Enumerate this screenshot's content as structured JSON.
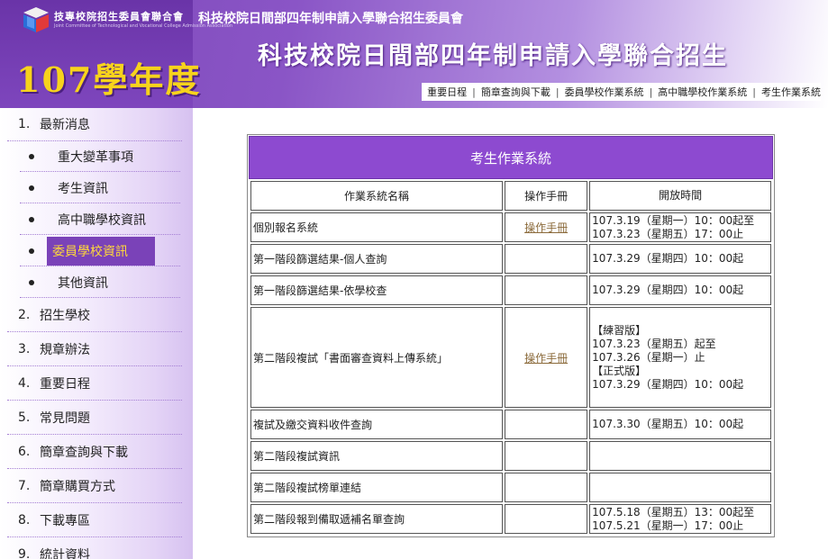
{
  "header": {
    "logo_text": "技專校院招生委員會聯合會",
    "logo_sub": "Joint Committee of Technological and Vocational College Admission Association",
    "year": "107學年度",
    "org_name": "科技校院日間部四年制申請入學聯合招生委員會",
    "title": "科技校院日間部四年制申請入學聯合招生",
    "nav": [
      {
        "label": "重要日程"
      },
      {
        "label": "簡章查詢與下載"
      },
      {
        "label": "委員學校作業系統"
      },
      {
        "label": "高中職學校作業系統"
      },
      {
        "label": "考生作業系統"
      }
    ]
  },
  "sidebar": {
    "items": [
      {
        "num": "1.",
        "label": "最新消息"
      },
      {
        "sub": true,
        "label": "重大變革事項"
      },
      {
        "sub": true,
        "label": "考生資訊"
      },
      {
        "sub": true,
        "label": "高中職學校資訊"
      },
      {
        "sub": true,
        "label": "委員學校資訊",
        "active": true
      },
      {
        "sub": true,
        "label": "其他資訊"
      },
      {
        "num": "2.",
        "label": "招生學校"
      },
      {
        "num": "3.",
        "label": "規章辦法"
      },
      {
        "num": "4.",
        "label": "重要日程"
      },
      {
        "num": "5.",
        "label": "常見問題"
      },
      {
        "num": "6.",
        "label": "簡章查詢與下載"
      },
      {
        "num": "7.",
        "label": "簡章購買方式"
      },
      {
        "num": "8.",
        "label": "下載專區"
      },
      {
        "num": "9.",
        "label": "統計資料"
      }
    ]
  },
  "panel": {
    "title": "考生作業系統",
    "headers": [
      "作業系統名稱",
      "操作手冊",
      "開放時間"
    ],
    "rows": [
      {
        "name": "個別報名系統",
        "manual": "操作手冊",
        "time": [
          "107.3.19（星期一）10：00起至",
          "107.3.23（星期五）17：00止"
        ]
      },
      {
        "name": "第一階段篩選結果-個人查詢",
        "manual": "",
        "time": [
          "107.3.29（星期四）10：00起"
        ]
      },
      {
        "name": "第一階段篩選結果-依學校查",
        "manual": "",
        "time": [
          "107.3.29（星期四）10：00起"
        ]
      },
      {
        "name": "第二階段複試「書面審查資料上傳系統」",
        "manual": "操作手冊",
        "time": [
          "【練習版】",
          "107.3.23（星期五）起至",
          "107.3.26（星期一）止",
          "【正式版】",
          "107.3.29（星期四）10：00起"
        ]
      },
      {
        "name": "複試及繳交資料收件查詢",
        "manual": "",
        "time": [
          "107.3.30（星期五）10：00起"
        ]
      },
      {
        "name": "第二階段複試資訊",
        "manual": "",
        "time": []
      },
      {
        "name": "第二階段複試榜單連結",
        "manual": "",
        "time": []
      },
      {
        "name": "第二階段報到備取遞補名單查詢",
        "manual": "",
        "time": [
          "107.5.18（星期五）13：00起至",
          "107.5.21（星期一）17：00止"
        ]
      }
    ]
  },
  "colors": {
    "header_purple": "#7c47b8",
    "panel_purple": "#8d4ad0",
    "year_gold": "#f7d31c",
    "active_bg": "#7a42b8",
    "active_text": "#ffd83a"
  }
}
